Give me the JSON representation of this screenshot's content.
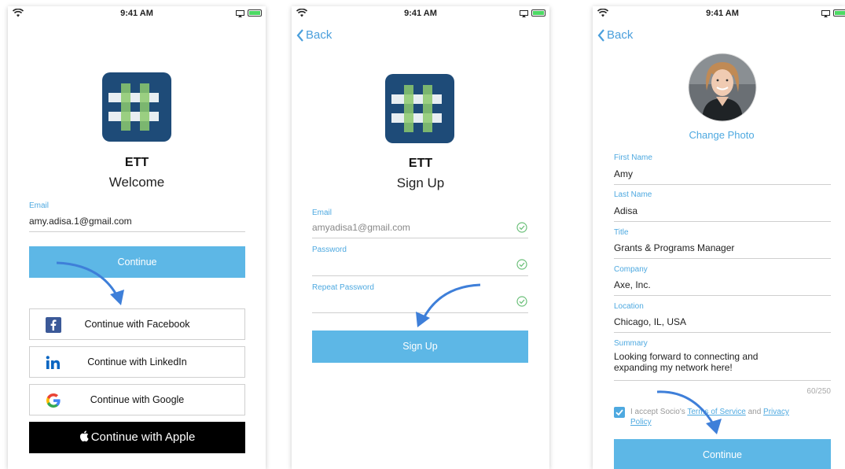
{
  "status": {
    "time": "9:41 AM"
  },
  "screen1": {
    "app_name": "ETT",
    "title": "Welcome",
    "email_label": "Email",
    "email_value": "amy.adisa.1@gmail.com",
    "continue_label": "Continue",
    "facebook_label": "Continue with Facebook",
    "linkedin_label": "Continue with LinkedIn",
    "google_label": "Continue with Google",
    "apple_label": "Continue with Apple",
    "colors": {
      "button": "#5db7e6",
      "apple": "#000000",
      "facebook": "#3b5998",
      "linkedin": "#0a66c2"
    }
  },
  "screen2": {
    "back_label": "Back",
    "app_name": "ETT",
    "title": "Sign Up",
    "email_label": "Email",
    "email_value": "amyadisa1@gmail.com",
    "password_label": "Password",
    "repeat_password_label": "Repeat Password",
    "signup_label": "Sign Up"
  },
  "screen3": {
    "back_label": "Back",
    "change_photo_label": "Change Photo",
    "fields": [
      {
        "label": "First Name",
        "value": "Amy"
      },
      {
        "label": "Last Name",
        "value": "Adisa"
      },
      {
        "label": "Title",
        "value": "Grants & Programs Manager"
      },
      {
        "label": "Company",
        "value": "Axe, Inc."
      },
      {
        "label": "Location",
        "value": "Chicago, IL, USA"
      }
    ],
    "summary_label": "Summary",
    "summary_line1": "Looking forward to connecting and",
    "summary_line2": "expanding my network here!",
    "char_count": "60/250",
    "terms_prefix": "I accept Socio's ",
    "terms_link": "Terms of Service",
    "terms_and": " and ",
    "privacy_link_1": "Privacy",
    "privacy_link_2": "Policy",
    "continue_label": "Continue"
  }
}
